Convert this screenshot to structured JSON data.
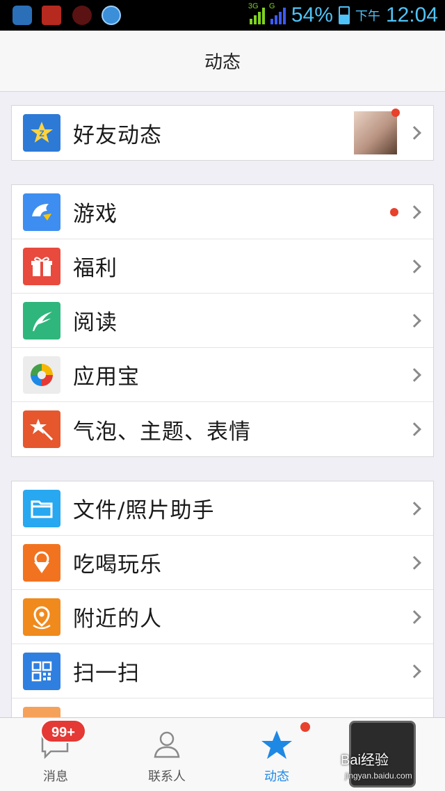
{
  "status_bar": {
    "network_3g": "3G",
    "network_g": "G",
    "battery": "54%",
    "ampm": "下午",
    "time": "12:04"
  },
  "header": {
    "title": "动态"
  },
  "groups": [
    {
      "items": [
        {
          "label": "好友动态",
          "icon": "qzone-star-icon",
          "color": "#2d7ad6"
        }
      ]
    },
    {
      "items": [
        {
          "label": "游戏",
          "icon": "game-shark-icon",
          "color": "#3d8ef0"
        },
        {
          "label": "福利",
          "icon": "gift-icon",
          "color": "#e84a3d"
        },
        {
          "label": "阅读",
          "icon": "feather-icon",
          "color": "#2fb67c"
        },
        {
          "label": "应用宝",
          "icon": "app-store-icon",
          "color": "#ececec"
        },
        {
          "label": "气泡、主题、表情",
          "icon": "magic-wand-icon",
          "color": "#e6572e"
        }
      ]
    },
    {
      "items": [
        {
          "label": "文件/照片助手",
          "icon": "folder-icon",
          "color": "#28a8f0"
        },
        {
          "label": "吃喝玩乐",
          "icon": "ice-cream-icon",
          "color": "#f2731f"
        },
        {
          "label": "附近的人",
          "icon": "location-pin-icon",
          "color": "#f08a1d"
        },
        {
          "label": "扫一扫",
          "icon": "qr-code-icon",
          "color": "#2f7fe0"
        }
      ]
    }
  ],
  "tabs": [
    {
      "label": "消息",
      "badge": "99+"
    },
    {
      "label": "联系人"
    },
    {
      "label": "动态"
    },
    {
      "label": ""
    }
  ],
  "watermark": {
    "text": "Bai经验",
    "sub": "jingyan.baidu.com"
  }
}
